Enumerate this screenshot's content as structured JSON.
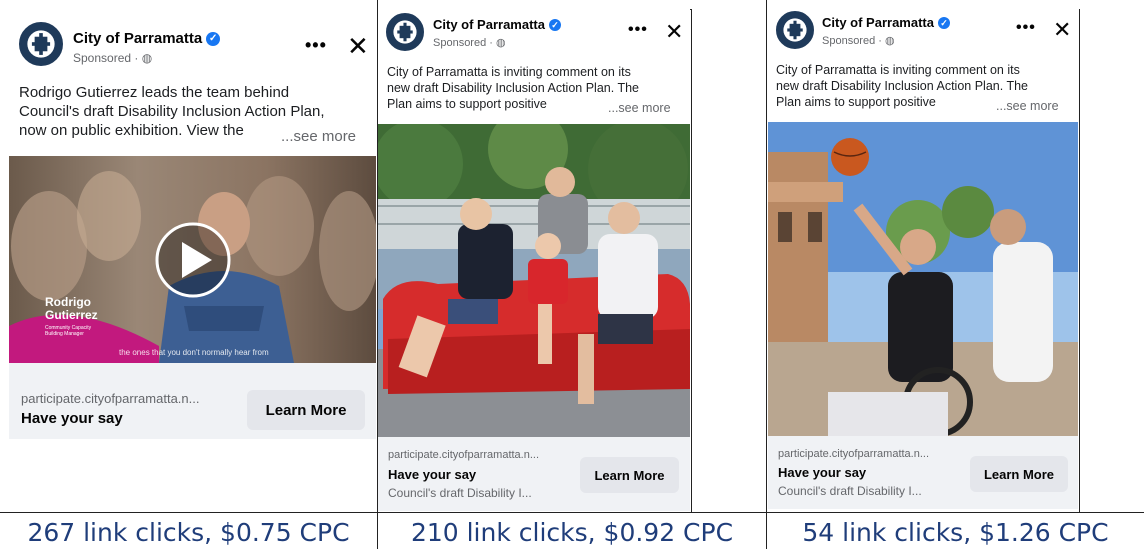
{
  "page_name": "City of Parramatta",
  "sponsored_label": "Sponsored ·",
  "cta_label": "Learn More",
  "see_more": "...see more",
  "colors": {
    "verified": "#1877f2",
    "stat_text": "#1f3d7a",
    "footer_bg": "#f0f2f5"
  },
  "ads": [
    {
      "body_lines": [
        "Rodrigo Gutierrez leads the team behind",
        "Council's draft Disability Inclusion Action Plan,",
        "now on public exhibition. View the"
      ],
      "media_type": "video",
      "video_overlay": {
        "name_line1": "Rodrigo",
        "name_line2": "Gutierrez",
        "role_line1": "Community Capacity",
        "role_line2": "Building Manager",
        "caption": "the ones that you don't normally hear from"
      },
      "domain": "participate.cityofparramatta.n...",
      "headline": "Have your say",
      "description": ""
    },
    {
      "body_lines": [
        "City of Parramatta is inviting comment on its",
        "new draft Disability Inclusion Action Plan. The",
        "Plan aims to support positive"
      ],
      "media_type": "photo",
      "domain": "participate.cityofparramatta.n...",
      "headline": "Have your say",
      "description": "Council's draft Disability I..."
    },
    {
      "body_lines": [
        "City of Parramatta is inviting comment on its",
        "new draft Disability Inclusion Action Plan. The",
        "Plan aims to support positive"
      ],
      "media_type": "photo",
      "domain": "participate.cityofparramatta.n...",
      "headline": "Have your say",
      "description": "Council's draft Disability I..."
    }
  ],
  "stats": [
    "267 link clicks, $0.75 CPC",
    "210 link clicks, $0.92 CPC",
    "54 link clicks, $1.26 CPC"
  ]
}
